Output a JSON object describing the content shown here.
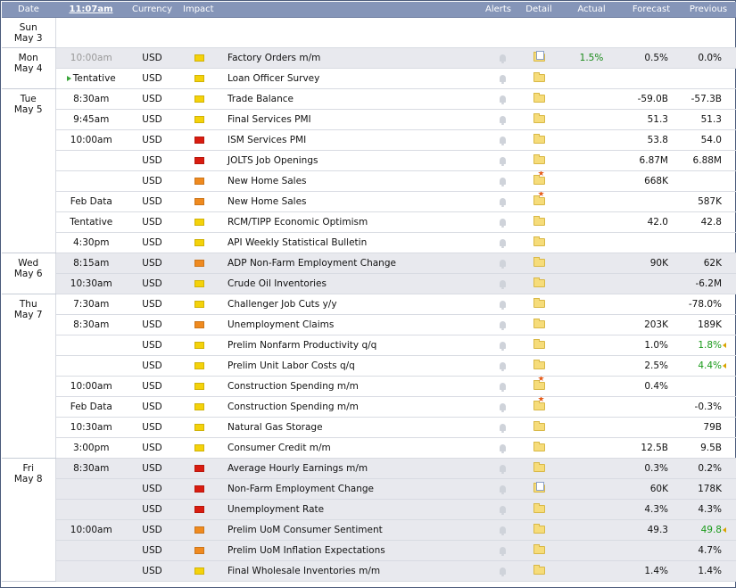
{
  "columns": {
    "date": "Date",
    "time": "11:07am",
    "currency": "Currency",
    "impact": "Impact",
    "alerts": "Alerts",
    "detail": "Detail",
    "actual": "Actual",
    "forecast": "Forecast",
    "previous": "Previous"
  },
  "days": [
    {
      "day": "Sun",
      "date": "May 3",
      "events": []
    },
    {
      "day": "Mon",
      "date": "May 4",
      "events": [
        {
          "time": "10:00am",
          "time_style": "grey",
          "currency": "USD",
          "impact": "low",
          "event": "Factory Orders m/m",
          "detail_icon": "doc",
          "actual": "1.5%",
          "forecast": "0.5%",
          "previous": "0.0%",
          "shade": true
        },
        {
          "time": "Tentative",
          "time_style": "tentative",
          "currency": "USD",
          "impact": "low",
          "event": "Loan Officer Survey",
          "detail_icon": "plain",
          "actual": "",
          "forecast": "",
          "previous": "",
          "shade": false
        }
      ]
    },
    {
      "day": "Tue",
      "date": "May 5",
      "events": [
        {
          "time": "8:30am",
          "currency": "USD",
          "impact": "low",
          "event": "Trade Balance",
          "detail_icon": "plain",
          "actual": "",
          "forecast": "-59.0B",
          "previous": "-57.3B",
          "shade": false
        },
        {
          "time": "9:45am",
          "currency": "USD",
          "impact": "low",
          "event": "Final Services PMI",
          "detail_icon": "plain",
          "actual": "",
          "forecast": "51.3",
          "previous": "51.3",
          "shade": false
        },
        {
          "time": "10:00am",
          "currency": "USD",
          "impact": "high",
          "event": "ISM Services PMI",
          "detail_icon": "plain",
          "actual": "",
          "forecast": "53.8",
          "previous": "54.0",
          "shade": false
        },
        {
          "time": "",
          "currency": "USD",
          "impact": "high",
          "event": "JOLTS Job Openings",
          "detail_icon": "plain",
          "actual": "",
          "forecast": "6.87M",
          "previous": "6.88M",
          "shade": false
        },
        {
          "time": "",
          "currency": "USD",
          "impact": "med",
          "event": "New Home Sales",
          "detail_icon": "star",
          "actual": "",
          "forecast": "668K",
          "previous": "",
          "shade": false
        },
        {
          "time": "Feb Data",
          "currency": "USD",
          "impact": "med",
          "event": "New Home Sales",
          "detail_icon": "star",
          "actual": "",
          "forecast": "",
          "previous": "587K",
          "shade": false
        },
        {
          "time": "Tentative",
          "currency": "USD",
          "impact": "low",
          "event": "RCM/TIPP Economic Optimism",
          "detail_icon": "plain",
          "actual": "",
          "forecast": "42.0",
          "previous": "42.8",
          "shade": false
        },
        {
          "time": "4:30pm",
          "currency": "USD",
          "impact": "low",
          "event": "API Weekly Statistical Bulletin",
          "detail_icon": "plain",
          "actual": "",
          "forecast": "",
          "previous": "",
          "shade": false
        }
      ]
    },
    {
      "day": "Wed",
      "date": "May 6",
      "events": [
        {
          "time": "8:15am",
          "currency": "USD",
          "impact": "med",
          "event": "ADP Non-Farm Employment Change",
          "detail_icon": "plain",
          "actual": "",
          "forecast": "90K",
          "previous": "62K",
          "shade": true
        },
        {
          "time": "10:30am",
          "currency": "USD",
          "impact": "low",
          "event": "Crude Oil Inventories",
          "detail_icon": "plain",
          "actual": "",
          "forecast": "",
          "previous": "-6.2M",
          "shade": true
        }
      ]
    },
    {
      "day": "Thu",
      "date": "May 7",
      "events": [
        {
          "time": "7:30am",
          "currency": "USD",
          "impact": "low",
          "event": "Challenger Job Cuts y/y",
          "detail_icon": "plain",
          "actual": "",
          "forecast": "",
          "previous": "-78.0%",
          "shade": false
        },
        {
          "time": "8:30am",
          "currency": "USD",
          "impact": "med",
          "event": "Unemployment Claims",
          "detail_icon": "plain",
          "actual": "",
          "forecast": "203K",
          "previous": "189K",
          "shade": false
        },
        {
          "time": "",
          "currency": "USD",
          "impact": "low",
          "event": "Prelim Nonfarm Productivity q/q",
          "detail_icon": "plain",
          "actual": "",
          "forecast": "1.0%",
          "previous": "1.8%",
          "previous_style": "revised",
          "shade": false
        },
        {
          "time": "",
          "currency": "USD",
          "impact": "low",
          "event": "Prelim Unit Labor Costs q/q",
          "detail_icon": "plain",
          "actual": "",
          "forecast": "2.5%",
          "previous": "4.4%",
          "previous_style": "revised",
          "shade": false
        },
        {
          "time": "10:00am",
          "currency": "USD",
          "impact": "low",
          "event": "Construction Spending m/m",
          "detail_icon": "star",
          "actual": "",
          "forecast": "0.4%",
          "previous": "",
          "shade": false
        },
        {
          "time": "Feb Data",
          "currency": "USD",
          "impact": "low",
          "event": "Construction Spending m/m",
          "detail_icon": "star",
          "actual": "",
          "forecast": "",
          "previous": "-0.3%",
          "shade": false
        },
        {
          "time": "10:30am",
          "currency": "USD",
          "impact": "low",
          "event": "Natural Gas Storage",
          "detail_icon": "plain",
          "actual": "",
          "forecast": "",
          "previous": "79B",
          "shade": false
        },
        {
          "time": "3:00pm",
          "currency": "USD",
          "impact": "low",
          "event": "Consumer Credit m/m",
          "detail_icon": "plain",
          "actual": "",
          "forecast": "12.5B",
          "previous": "9.5B",
          "shade": false
        }
      ]
    },
    {
      "day": "Fri",
      "date": "May 8",
      "events": [
        {
          "time": "8:30am",
          "currency": "USD",
          "impact": "high",
          "event": "Average Hourly Earnings m/m",
          "detail_icon": "plain",
          "actual": "",
          "forecast": "0.3%",
          "previous": "0.2%",
          "shade": true
        },
        {
          "time": "",
          "currency": "USD",
          "impact": "high",
          "event": "Non-Farm Employment Change",
          "detail_icon": "doc",
          "actual": "",
          "forecast": "60K",
          "previous": "178K",
          "shade": true
        },
        {
          "time": "",
          "currency": "USD",
          "impact": "high",
          "event": "Unemployment Rate",
          "detail_icon": "plain",
          "actual": "",
          "forecast": "4.3%",
          "previous": "4.3%",
          "shade": true
        },
        {
          "time": "10:00am",
          "currency": "USD",
          "impact": "med",
          "event": "Prelim UoM Consumer Sentiment",
          "detail_icon": "plain",
          "actual": "",
          "forecast": "49.3",
          "previous": "49.8",
          "previous_style": "revised",
          "shade": true
        },
        {
          "time": "",
          "currency": "USD",
          "impact": "med",
          "event": "Prelim UoM Inflation Expectations",
          "detail_icon": "plain",
          "actual": "",
          "forecast": "",
          "previous": "4.7%",
          "shade": true
        },
        {
          "time": "",
          "currency": "USD",
          "impact": "low",
          "event": "Final Wholesale Inventories m/m",
          "detail_icon": "plain",
          "actual": "",
          "forecast": "1.4%",
          "previous": "1.4%",
          "shade": true
        }
      ]
    }
  ]
}
